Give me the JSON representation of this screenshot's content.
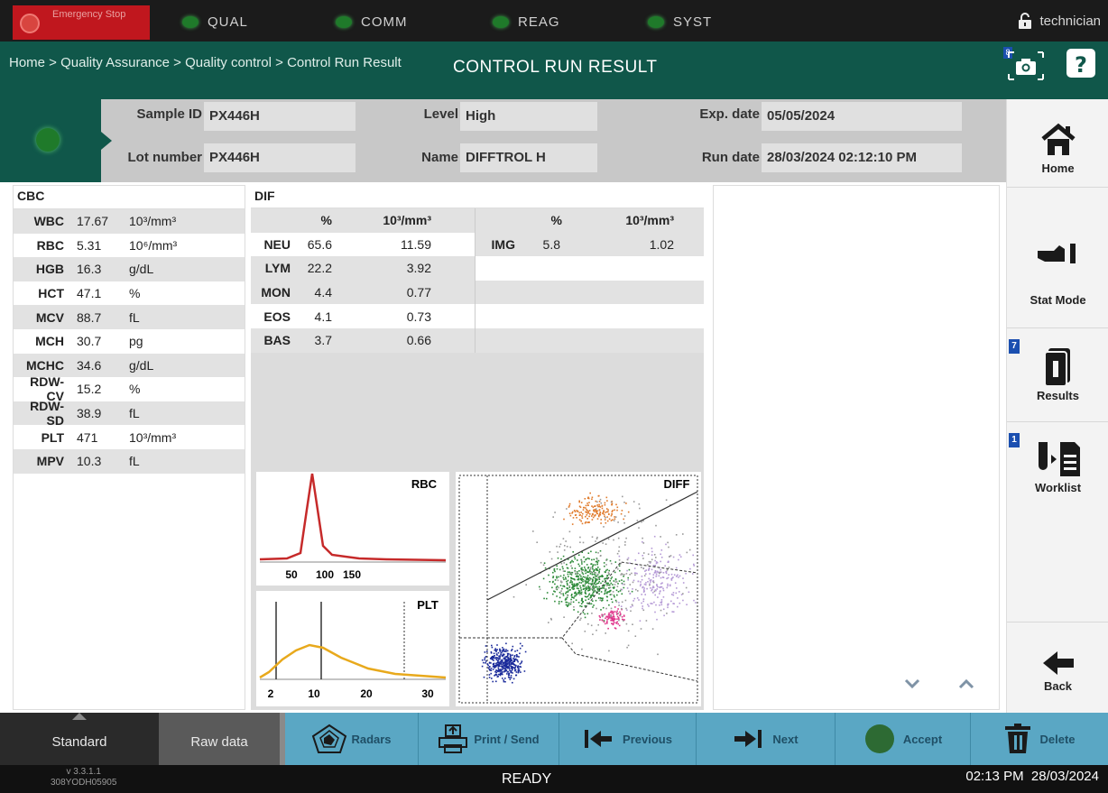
{
  "status_bar": {
    "emergency_label": "Emergency Stop",
    "indicators": [
      {
        "label": "QUAL",
        "color": "#1f7a2a"
      },
      {
        "label": "COMM",
        "color": "#1f7a2a"
      },
      {
        "label": "REAG",
        "color": "#1f7a2a"
      },
      {
        "label": "SYST",
        "color": "#1f7a2a"
      }
    ],
    "user": "technician"
  },
  "header": {
    "breadcrumb": "Home > Quality Assurance > Quality control > Control Run Result",
    "title": "CONTROL RUN RESULT",
    "camera_badge": "8",
    "help_icon": "question-icon"
  },
  "sample_info": {
    "sample_id_label": "Sample ID",
    "sample_id": "PX446H",
    "lot_label": "Lot number",
    "lot": "PX446H",
    "level_label": "Level",
    "level": "High",
    "name_label": "Name",
    "name": "DIFFTROL H",
    "exp_label": "Exp. date",
    "exp": "05/05/2024",
    "run_label": "Run date",
    "run": "28/03/2024 02:12:10 PM"
  },
  "cbc": {
    "title": "CBC",
    "rows": [
      {
        "name": "WBC",
        "value": "17.67",
        "unit": "10³/mm³"
      },
      {
        "name": "RBC",
        "value": "5.31",
        "unit": "10⁶/mm³"
      },
      {
        "name": "HGB",
        "value": "16.3",
        "unit": "g/dL"
      },
      {
        "name": "HCT",
        "value": "47.1",
        "unit": "%"
      },
      {
        "name": "MCV",
        "value": "88.7",
        "unit": "fL"
      },
      {
        "name": "MCH",
        "value": "30.7",
        "unit": "pg"
      },
      {
        "name": "MCHC",
        "value": "34.6",
        "unit": "g/dL"
      },
      {
        "name": "RDW-CV",
        "value": "15.2",
        "unit": "%"
      },
      {
        "name": "RDW-SD",
        "value": "38.9",
        "unit": "fL"
      },
      {
        "name": "PLT",
        "value": "471",
        "unit": "10³/mm³"
      },
      {
        "name": "MPV",
        "value": "10.3",
        "unit": "fL"
      }
    ]
  },
  "dif": {
    "title": "DIF",
    "col_pct": "%",
    "col_abs": "10³/mm³",
    "left_rows": [
      {
        "name": "NEU",
        "pct": "65.6",
        "abs": "11.59"
      },
      {
        "name": "LYM",
        "pct": "22.2",
        "abs": "3.92"
      },
      {
        "name": "MON",
        "pct": "4.4",
        "abs": "0.77"
      },
      {
        "name": "EOS",
        "pct": "4.1",
        "abs": "0.73"
      },
      {
        "name": "BAS",
        "pct": "3.7",
        "abs": "0.66"
      }
    ],
    "right_rows": [
      {
        "name": "IMG",
        "pct": "5.8",
        "abs": "1.02"
      }
    ]
  },
  "graphs": {
    "rbc": {
      "label": "RBC",
      "ticks": [
        "50",
        "100",
        "150"
      ],
      "color": "#c62a2a"
    },
    "plt": {
      "label": "PLT",
      "ticks": [
        "2",
        "10",
        "20",
        "30"
      ],
      "color": "#e8a91c"
    },
    "diff": {
      "label": "DIFF"
    }
  },
  "sidebar": {
    "home": "Home",
    "stat": "Stat Mode",
    "results": "Results",
    "results_badge": "7",
    "worklist": "Worklist",
    "worklist_badge": "1",
    "back": "Back"
  },
  "bottom": {
    "tab_standard": "Standard",
    "tab_raw": "Raw data",
    "radars": "Radars",
    "print": "Print / Send",
    "previous": "Previous",
    "next": "Next",
    "accept": "Accept",
    "delete": "Delete"
  },
  "footer": {
    "version": "v 3.3.1.1",
    "serial": "308YODH05905",
    "status": "READY",
    "time": "02:13 PM",
    "date": "28/03/2024"
  }
}
